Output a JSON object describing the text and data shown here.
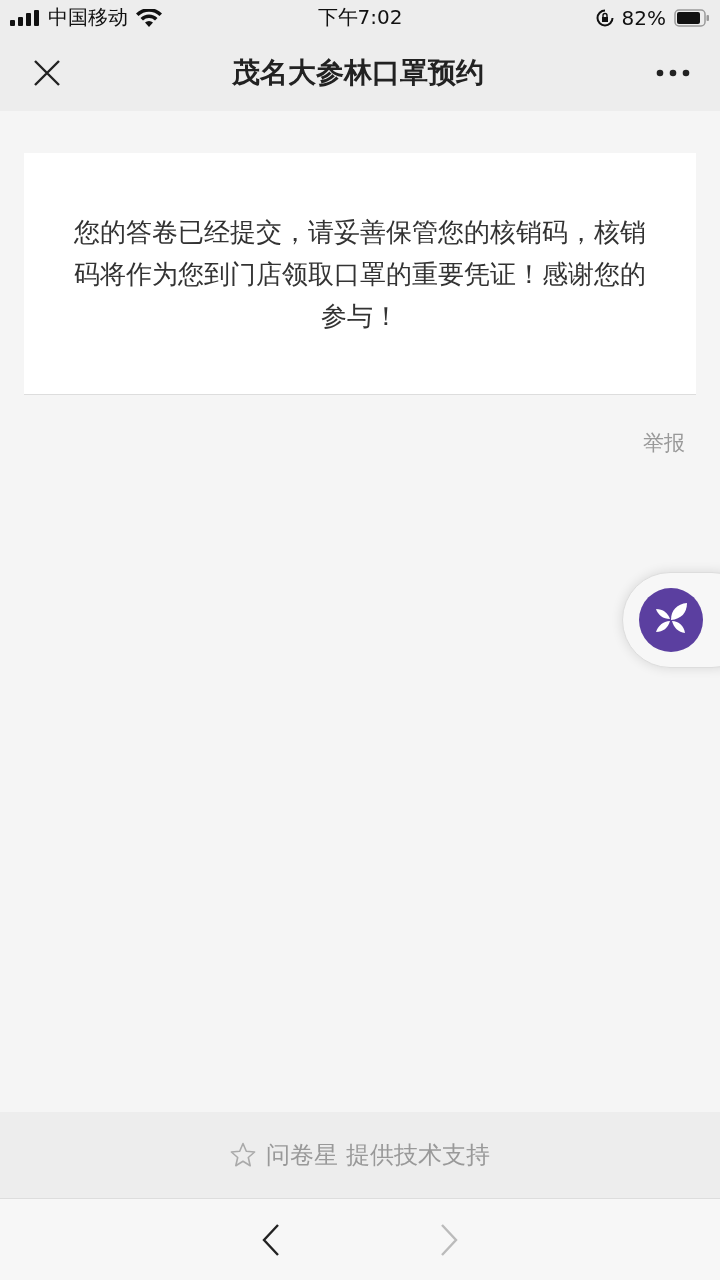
{
  "status_bar": {
    "carrier": "中国移动",
    "time": "下午7:02",
    "battery": "82%"
  },
  "nav": {
    "title": "茂名大参林口罩预约"
  },
  "message": "您的答卷已经提交，请妥善保管您的核销码，核销码将作为您到门店领取口罩的重要凭证！感谢您的参与！",
  "report_link": "举报",
  "footer": "问卷星 提供技术支持",
  "browser_buttons": [
    {
      "kind": "back",
      "disabled": false
    },
    {
      "kind": "forward",
      "disabled": true
    }
  ]
}
